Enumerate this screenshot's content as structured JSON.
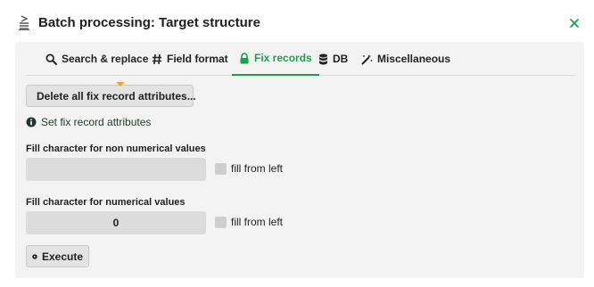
{
  "window": {
    "title": "Batch processing: Target structure",
    "icon": "stack-icon",
    "close_icon": "close-icon"
  },
  "tabs": [
    {
      "label": "Search & replace",
      "icon": "search-icon",
      "active": false
    },
    {
      "label": "Field format",
      "icon": "hash-icon",
      "active": false
    },
    {
      "label": "Fix records",
      "icon": "lock-icon",
      "active": true
    },
    {
      "label": "DB",
      "icon": "database-icon",
      "active": false
    },
    {
      "label": "Miscellaneous",
      "icon": "magic-wand-icon",
      "active": false
    }
  ],
  "fix_records": {
    "delete_button_label": "Delete all fix record attributes...",
    "info_text": "Set fix record attributes",
    "non_numerical": {
      "label": "Fill character for non numerical values",
      "value": "",
      "fill_from_left_label": "fill from left",
      "fill_from_left_checked": false
    },
    "numerical": {
      "label": "Fill character for numerical values",
      "value": "0",
      "fill_from_left_label": "fill from left",
      "fill_from_left_checked": false
    },
    "execute_label": "Execute"
  },
  "colors": {
    "accent": "#17a34a",
    "caret": "#f1a634",
    "panel_bg": "#f3f3f3"
  }
}
